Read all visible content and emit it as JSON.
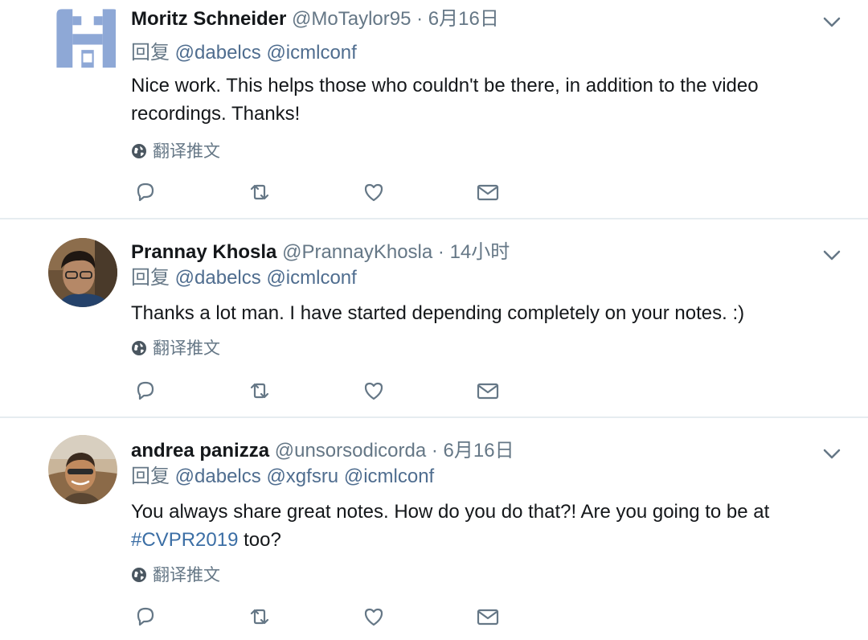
{
  "colors": {
    "text_primary": "#14171a",
    "text_secondary": "#657786",
    "link": "#4f6d8f",
    "hashtag": "#3b6ea5",
    "divider": "#e6ecf0"
  },
  "icons": {
    "caret": "chevron-down-icon",
    "translate": "globe-icon",
    "reply": "reply-icon",
    "retweet": "retweet-icon",
    "like": "heart-icon",
    "dm": "envelope-icon"
  },
  "tweets": [
    {
      "name": "Moritz Schneider",
      "handle": "@MoTaylor95",
      "dot": "·",
      "time": "6月16日",
      "reply_prefix": "回复",
      "mentions": [
        "@dabelcs",
        "@icmlconf"
      ],
      "text": "Nice work. This helps those who couldn't be there, in addition to the video recordings. Thanks!",
      "translate": "翻译推文"
    },
    {
      "name": "Prannay Khosla",
      "handle": "@PrannayKhosla",
      "dot": "·",
      "time": "14小时",
      "reply_prefix": "回复",
      "mentions": [
        "@dabelcs",
        "@icmlconf"
      ],
      "text": "Thanks a lot man. I have started depending completely on your notes. :)",
      "translate": "翻译推文"
    },
    {
      "name": "andrea panizza",
      "handle": "@unsorsodicorda",
      "dot": "·",
      "time": "6月16日",
      "reply_prefix": "回复",
      "mentions": [
        "@dabelcs",
        "@xgfsru",
        "@icmlconf"
      ],
      "text_before": "You always share great notes. How do you do that?! Are you going to be at",
      "hashtag": "#CVPR2019",
      "text_after": " too?",
      "translate": "翻译推文"
    }
  ]
}
